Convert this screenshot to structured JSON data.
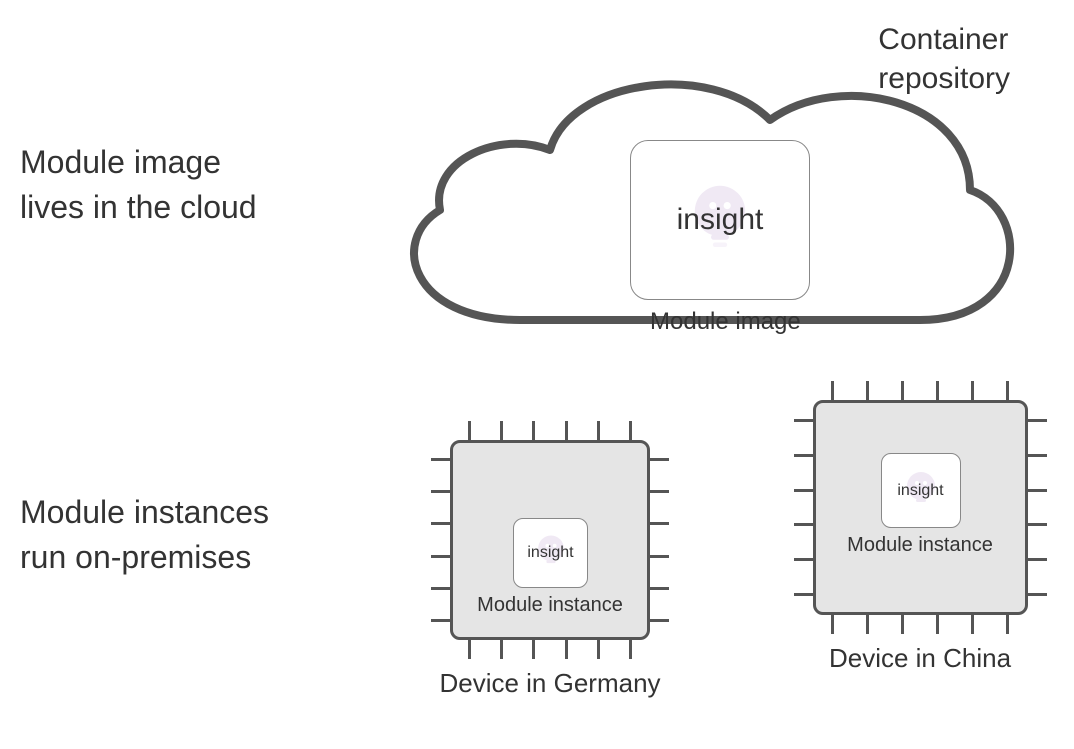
{
  "left_labels": {
    "cloud_line1": "Module image",
    "cloud_line2": "lives in the cloud",
    "onprem_line1": "Module instances",
    "onprem_line2": "run on-premises"
  },
  "cloud": {
    "title_line1": "Container",
    "title_line2": "repository",
    "module_box": {
      "insight": "insight",
      "caption": "Module image"
    }
  },
  "instance_caption": "Module instance",
  "chips": [
    {
      "insight": "insight",
      "device_label": "Device in Germany"
    },
    {
      "insight": "insight",
      "device_label": "Device in China"
    }
  ]
}
